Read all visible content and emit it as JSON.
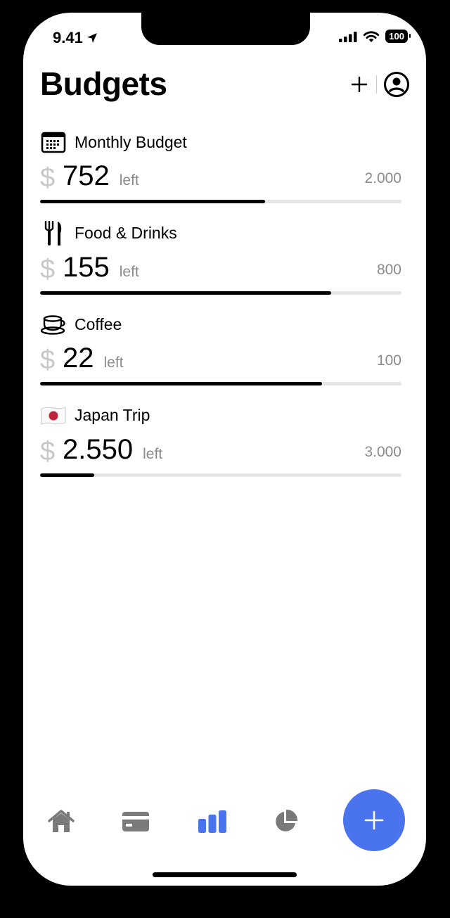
{
  "status": {
    "time": "9.41",
    "battery": "100"
  },
  "header": {
    "title": "Budgets"
  },
  "budgets": [
    {
      "name": "Monthly Budget",
      "currency": "$",
      "left": "752",
      "left_label": "left",
      "total": "2.000",
      "progress": 0.623,
      "icon": "calendar-icon"
    },
    {
      "name": "Food & Drinks",
      "currency": "$",
      "left": "155",
      "left_label": "left",
      "total": "800",
      "progress": 0.806,
      "icon": "fork-knife-icon"
    },
    {
      "name": "Coffee",
      "currency": "$",
      "left": "22",
      "left_label": "left",
      "total": "100",
      "progress": 0.78,
      "icon": "coffee-cup-icon"
    },
    {
      "name": "Japan Trip",
      "currency": "$",
      "left": "2.550",
      "left_label": "left",
      "total": "3.000",
      "progress": 0.15,
      "icon": "japan-flag-icon"
    }
  ],
  "tabs": [
    {
      "icon": "house-icon",
      "active": false
    },
    {
      "icon": "credit-card-icon",
      "active": false
    },
    {
      "icon": "bar-chart-icon",
      "active": true
    },
    {
      "icon": "pie-chart-icon",
      "active": false
    }
  ],
  "colors": {
    "accent": "#4a74ed",
    "inactive_tab": "#7a7a7a",
    "progress_track": "#e6e6e6",
    "progress_fill": "#000000",
    "muted_text": "#8a8a8a"
  }
}
